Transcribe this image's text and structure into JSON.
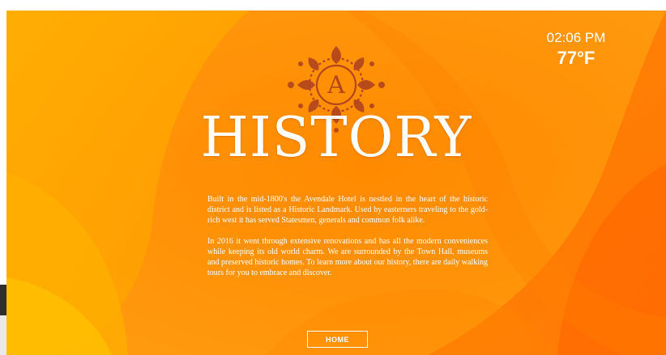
{
  "clock": {
    "time": "02:06 PM",
    "temperature": "77°F"
  },
  "emblem": {
    "letter": "A",
    "icon": "ornate-mandala-monogram-icon"
  },
  "page": {
    "title": "HISTORY",
    "paragraphs": [
      "Built in the mid-1800's the Avendale Hotel is nestled in the heart of the historic district and is listed as a Historic Landmark. Used by easterners traveling to the gold-rich west it has served Statesmen, generals and common folk alike.",
      "In 2016 it went through extensive renovations and has all the modern conveniences while keeping its old world charm. We are surrounded by the Town Hall, museums and preserved historic homes. To learn more about our history, there are daily walking tours for you to embrace and discover."
    ]
  },
  "nav": {
    "home_label": "HOME"
  },
  "colors": {
    "background_primary": "#ff9a12",
    "background_deep": "#ff6a00",
    "background_light": "#ffb800",
    "emblem": "#b3461e",
    "text": "#ffffff"
  }
}
